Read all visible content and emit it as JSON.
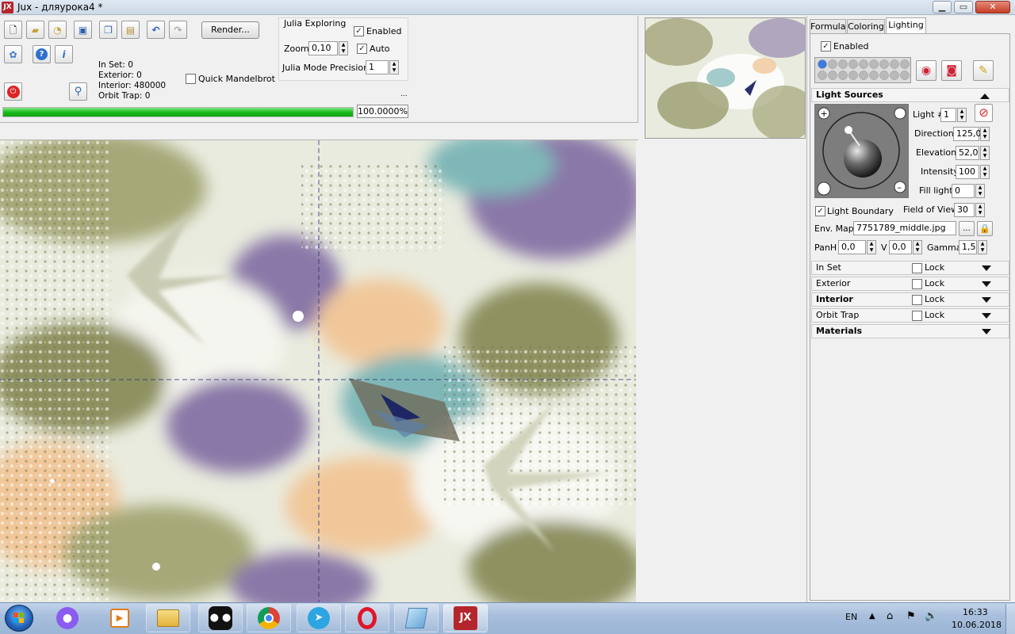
{
  "window": {
    "title": "Jux - дляурока4 *",
    "app_icon_text": "JX",
    "minimize": "▁",
    "maximize": "▭",
    "close": "✕"
  },
  "toolbar": {
    "row1_icons": [
      "new-icon",
      "open-icon",
      "recent-icon",
      "save-icon",
      "copy-icon",
      "paste-icon",
      "undo-icon",
      "redo-icon"
    ],
    "row2_icons": [
      "settings-icon",
      "help-icon",
      "info-icon"
    ],
    "render_label": "Render...",
    "stats": {
      "in_set": "In Set: 0",
      "exterior": "Exterior: 0",
      "interior": "Interior: 480000",
      "orbit_trap": "Orbit Trap: 0"
    },
    "quick_mandelbrot_label": "Quick Mandelbrot",
    "quick_mandelbrot_checked": false
  },
  "julia": {
    "title": "Julia Exploring",
    "enabled_label": "Enabled",
    "enabled_checked": true,
    "zoom_label": "Zoom",
    "zoom_value": "0,10",
    "auto_label": "Auto",
    "auto_checked": true,
    "precision_label": "Julia Mode Precision",
    "precision_value": "1",
    "ellipsis": "..."
  },
  "progress": {
    "fraction": 1.0,
    "text": "100.0000%"
  },
  "tabs": [
    {
      "label": "Formula",
      "active": false
    },
    {
      "label": "Coloring",
      "active": false
    },
    {
      "label": "Lighting",
      "active": true
    }
  ],
  "lighting": {
    "enabled_label": "Enabled",
    "enabled_checked": true,
    "light_sources_title": "Light Sources",
    "light_num_label": "Light #",
    "light_num_value": "1",
    "direction_label": "Direction",
    "direction_value": "125,0",
    "elevation_label": "Elevation",
    "elevation_value": "52,0",
    "intensity_label": "Intensity",
    "intensity_value": "100",
    "fill_light_label": "Fill light",
    "fill_light_value": "0",
    "light_boundary_label": "Light Boundary",
    "light_boundary_checked": true,
    "fov_label": "Field of View",
    "fov_value": "30",
    "env_map_label": "Env. Map",
    "env_map_value": "7751789_middle.jpg",
    "browse_label": "...",
    "panh_label": "PanH",
    "panh_value": "0,0",
    "v_label": "V",
    "v_value": "0,0",
    "gamma_label": "Gamma",
    "gamma_value": "1,5"
  },
  "sections": [
    {
      "label": "In Set",
      "lock_label": "Lock",
      "bold": false,
      "has_lock": true
    },
    {
      "label": "Exterior",
      "lock_label": "Lock",
      "bold": false,
      "has_lock": true
    },
    {
      "label": "Interior",
      "lock_label": "Lock",
      "bold": true,
      "has_lock": true
    },
    {
      "label": "Orbit Trap",
      "lock_label": "Lock",
      "bold": false,
      "has_lock": true
    },
    {
      "label": "Materials",
      "lock_label": "",
      "bold": true,
      "has_lock": false
    }
  ],
  "taskbar": {
    "apps": [
      "windows-start",
      "voice-recorder",
      "media-player",
      "file-explorer",
      "app-eyes",
      "chrome",
      "telegram",
      "opera",
      "notepad",
      "jux"
    ],
    "language": "EN",
    "time": "16:33",
    "date": "10.06.2018"
  },
  "colors": {
    "progress_green": "#18b818",
    "close_red": "#c43d25",
    "fractal_olive": "#8e9160",
    "fractal_purple": "#8a78a8",
    "fractal_teal": "#7fb7b8",
    "fractal_peach": "#f1c79a"
  }
}
